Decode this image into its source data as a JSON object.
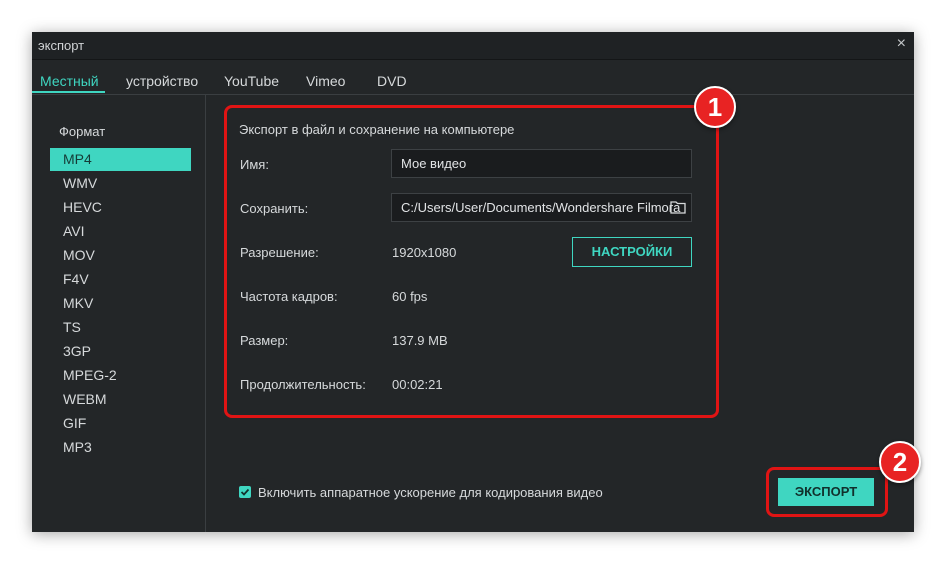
{
  "window": {
    "title": "экспорт",
    "close_glyph": "×"
  },
  "tabs": [
    {
      "label": "Местный",
      "active": true
    },
    {
      "label": "устройство"
    },
    {
      "label": "YouTube"
    },
    {
      "label": "Vimeo"
    },
    {
      "label": "DVD"
    }
  ],
  "sidebar": {
    "heading": "Формат",
    "selected": "MP4",
    "formats": [
      "MP4",
      "WMV",
      "HEVC",
      "AVI",
      "MOV",
      "F4V",
      "MKV",
      "TS",
      "3GP",
      "MPEG-2",
      "WEBM",
      "GIF",
      "MP3"
    ]
  },
  "panel": {
    "title": "Экспорт в файл и сохранение на компьютере",
    "name_label": "Имя:",
    "name_value": "Мое видео",
    "save_label": "Сохранить:",
    "save_value": "C:/Users/User/Documents/Wondershare Filmora",
    "resolution_label": "Разрешение:",
    "resolution_value": "1920x1080",
    "settings_button": "НАСТРОЙКИ",
    "framerate_label": "Частота кадров:",
    "framerate_value": "60 fps",
    "size_label": "Размер:",
    "size_value": "137.9 MB",
    "duration_label": "Продолжительность:",
    "duration_value": "00:02:21"
  },
  "footer": {
    "hw_accel_checked": true,
    "hw_accel_label": "Включить аппаратное ускорение для кодирования видео",
    "export_button": "ЭКСПОРТ"
  },
  "annotations": {
    "marker_1": "1",
    "marker_2": "2"
  },
  "icons": {
    "folder": "folder-icon",
    "checkmark": "checkmark-icon",
    "close": "close-icon"
  },
  "colors": {
    "accent": "#3fd6c1",
    "window_bg": "#232628",
    "annotation": "#e01414"
  }
}
